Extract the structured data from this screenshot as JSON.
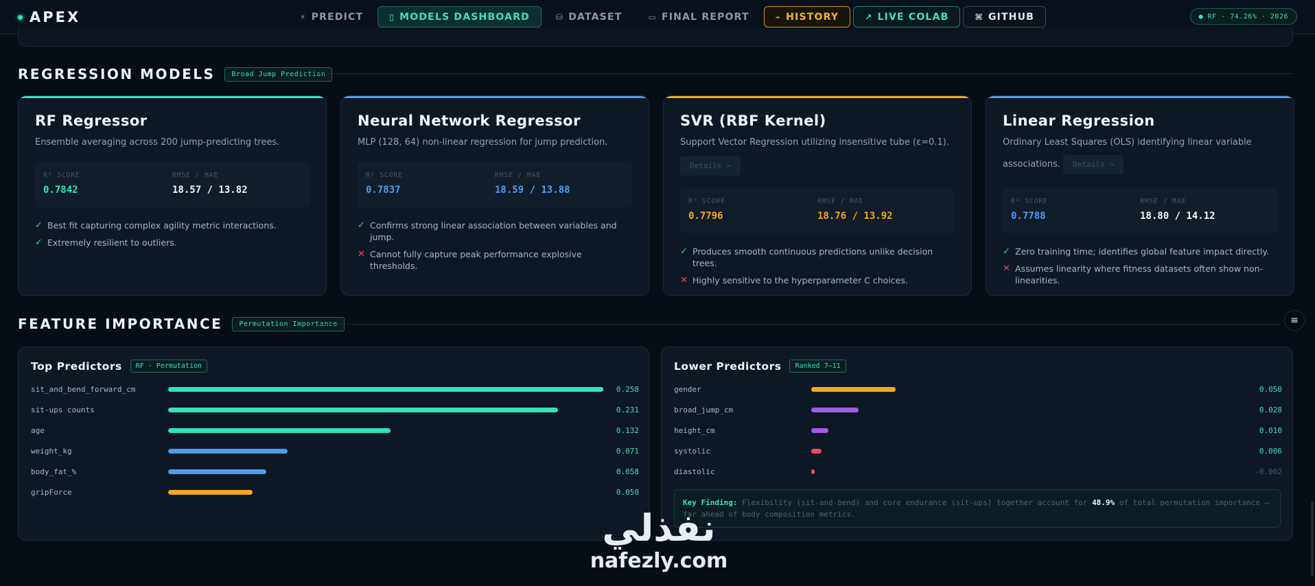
{
  "nav": {
    "brand": "APEX",
    "items": [
      {
        "label": "PREDICT",
        "icon": "⚡",
        "icon_name": "bolt-icon"
      },
      {
        "label": "MODELS DASHBOARD",
        "icon": "▯",
        "icon_name": "panel-icon"
      },
      {
        "label": "DATASET",
        "icon": "⛁",
        "icon_name": "database-icon"
      },
      {
        "label": "FINAL REPORT",
        "icon": "▭",
        "icon_name": "document-icon"
      },
      {
        "label": "HISTORY",
        "icon": "⌁",
        "icon_name": "pulse-icon"
      },
      {
        "label": "LIVE COLAB",
        "icon": "↗",
        "icon_name": "external-link-icon"
      },
      {
        "label": "GITHUB",
        "icon": "⌘",
        "icon_name": "github-icon"
      }
    ],
    "status_pill": "● RF · 74.26% · 2026"
  },
  "regression": {
    "title": "REGRESSION MODELS",
    "tag": "Broad Jump Prediction",
    "cards": [
      {
        "title": "RF Regressor",
        "desc": "Ensemble averaging across 200 jump-predicting trees.",
        "r2_label": "R² SCORE",
        "r2": "0.7842",
        "err_label": "RMSE / MAE",
        "err": "18.57 / 13.82",
        "points": [
          {
            "sym": "✓",
            "text": "Best fit capturing complex agility metric interactions."
          },
          {
            "sym": "✓",
            "text": "Extremely resilient to outliers."
          }
        ]
      },
      {
        "title": "Neural Network Regressor",
        "desc": "MLP (128, 64) non-linear regression for jump prediction.",
        "r2_label": "R² SCORE",
        "r2": "0.7837",
        "err_label": "RMSE / MAE",
        "err": "18.59 / 13.88",
        "points": [
          {
            "sym": "✓",
            "text": "Confirms strong linear association between variables and jump."
          },
          {
            "sym": "✕",
            "text": "Cannot fully capture peak performance explosive thresholds."
          }
        ]
      },
      {
        "title": "SVR (RBF Kernel)",
        "desc": "Support Vector Regression utilizing insensitive tube (ε=0.1).",
        "details": "Details →",
        "r2_label": "R² SCORE",
        "r2": "0.7796",
        "err_label": "RMSE / MAE",
        "err": "18.76 / 13.92",
        "points": [
          {
            "sym": "✓",
            "text": "Produces smooth continuous predictions unlike decision trees."
          },
          {
            "sym": "✕",
            "text": "Highly sensitive to the hyperparameter C choices."
          }
        ]
      },
      {
        "title": "Linear Regression",
        "desc": "Ordinary Least Squares (OLS) identifying linear variable associations.",
        "details": "Details →",
        "r2_label": "R² SCORE",
        "r2": "0.7788",
        "err_label": "RMSE / MAE",
        "err": "18.80 / 14.12",
        "points": [
          {
            "sym": "✓",
            "text": "Zero training time; identifies global feature impact directly."
          },
          {
            "sym": "✕",
            "text": "Assumes linearity where fitness datasets often show non-linearities."
          }
        ]
      }
    ]
  },
  "features": {
    "title": "FEATURE IMPORTANCE",
    "tag": "Permutation Importance",
    "top": {
      "title": "Top Predictors",
      "tag": "RF · Permutation",
      "rows": [
        {
          "name": "sit_and_bend_forward_cm",
          "value": 0.258,
          "label": "0.258",
          "color": "#2fe3c0"
        },
        {
          "name": "sit-ups counts",
          "value": 0.231,
          "label": "0.231",
          "color": "#2fe3c0"
        },
        {
          "name": "age",
          "value": 0.132,
          "label": "0.132",
          "color": "#2fe3c0"
        },
        {
          "name": "weight_kg",
          "value": 0.071,
          "label": "0.071",
          "color": "#4d9cf0"
        },
        {
          "name": "body_fat_%",
          "value": 0.058,
          "label": "0.058",
          "color": "#4d9cf0"
        },
        {
          "name": "gripForce",
          "value": 0.05,
          "label": "0.050",
          "color": "#f2a91e"
        }
      ]
    },
    "lower": {
      "title": "Lower Predictors",
      "tag": "Ranked 7–11",
      "rows": [
        {
          "name": "gender",
          "value": 0.05,
          "label": "0.050",
          "color": "#f2a91e"
        },
        {
          "name": "broad_jump_cm",
          "value": 0.028,
          "label": "0.028",
          "color": "#a45de8"
        },
        {
          "name": "height_cm",
          "value": 0.01,
          "label": "0.010",
          "color": "#a45de8"
        },
        {
          "name": "systolic",
          "value": 0.006,
          "label": "0.006",
          "color": "#ef4a5a"
        },
        {
          "name": "diastolic",
          "value": -0.002,
          "label": "-0.002",
          "color": "#ef4a5a"
        }
      ],
      "finding_label": "Key Finding:",
      "finding_pre": "Flexibility (sit-and-bend) and core endurance (sit-ups) together account for",
      "finding_pct": "48.9%",
      "finding_post": "of total permutation importance — far ahead of body composition metrics."
    }
  },
  "watermark": {
    "arabic": "نفذلي",
    "latin": "nafezly.com"
  },
  "float_icon": "≡"
}
